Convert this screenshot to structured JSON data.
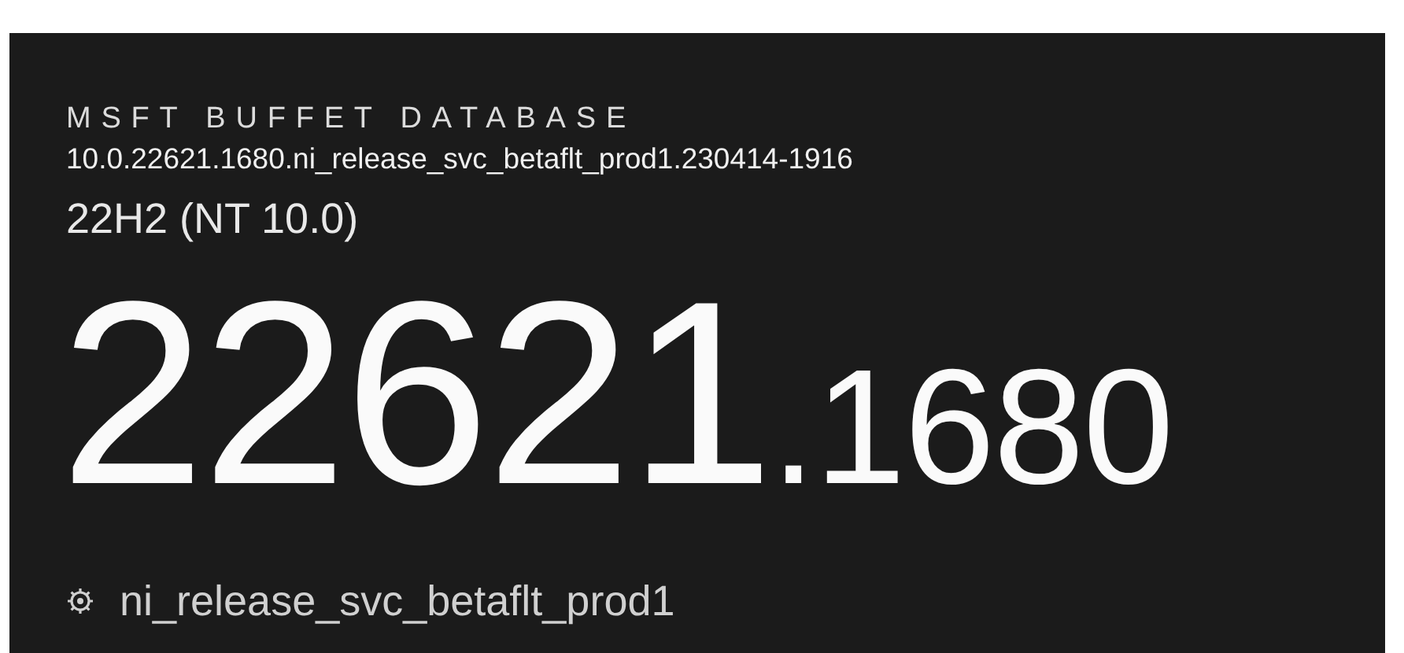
{
  "header": {
    "title": "MSFT BUFFET DATABASE",
    "build_string": "10.0.22621.1680.ni_release_svc_betaflt_prod1.230414-1916",
    "version": "22H2 (NT 10.0)"
  },
  "build_number": {
    "major": "22621",
    "minor": ".1680"
  },
  "branch": {
    "name": "ni_release_svc_betaflt_prod1"
  }
}
